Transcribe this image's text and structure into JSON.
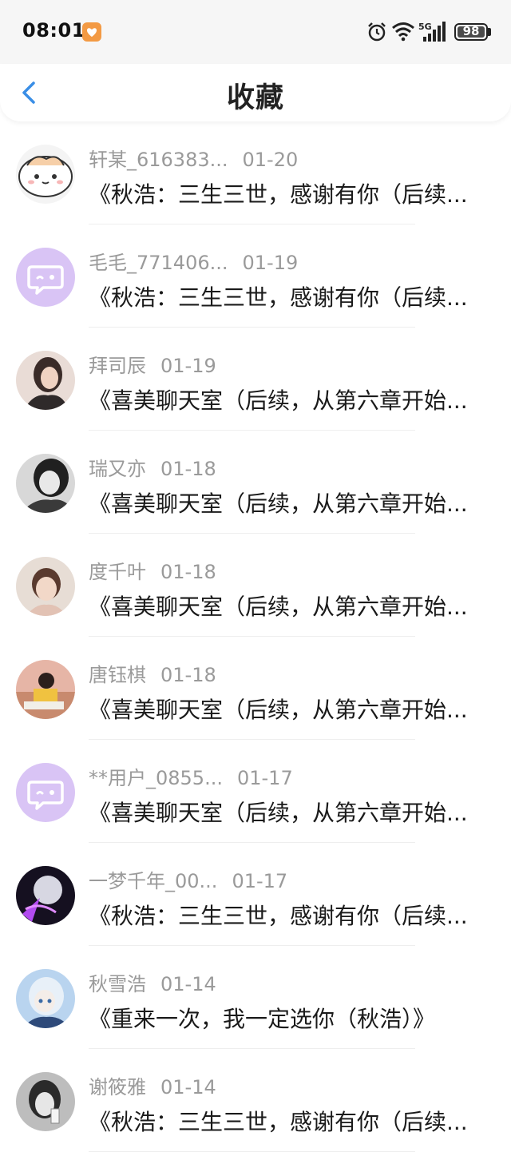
{
  "status": {
    "time": "08:01",
    "network": "5G",
    "battery": "98"
  },
  "nav": {
    "title": "收藏"
  },
  "items": [
    {
      "name": "轩某_616383...",
      "date": "01-20",
      "title": "《秋浩：三生三世，感谢有你（后续...",
      "avatar": "cat"
    },
    {
      "name": "毛毛_771406...",
      "date": "01-19",
      "title": "《秋浩：三生三世，感谢有你（后续...",
      "avatar": "chat"
    },
    {
      "name": "拜司辰",
      "date": "01-19",
      "title": "《喜美聊天室（后续，从第六章开始...",
      "avatar": "photo1"
    },
    {
      "name": "瑞又亦",
      "date": "01-18",
      "title": "《喜美聊天室（后续，从第六章开始...",
      "avatar": "photo2"
    },
    {
      "name": "度千叶",
      "date": "01-18",
      "title": "《喜美聊天室（后续，从第六章开始...",
      "avatar": "photo3"
    },
    {
      "name": "唐钰棋",
      "date": "01-18",
      "title": "《喜美聊天室（后续，从第六章开始...",
      "avatar": "photo4"
    },
    {
      "name": "**用户_0855...",
      "date": "01-17",
      "title": "《喜美聊天室（后续，从第六章开始...",
      "avatar": "chat"
    },
    {
      "name": "一梦千年_00...",
      "date": "01-17",
      "title": "《秋浩：三生三世，感谢有你（后续...",
      "avatar": "photo5"
    },
    {
      "name": "秋雪浩",
      "date": "01-14",
      "title": "《重来一次，我一定选你（秋浩）》",
      "avatar": "photo6"
    },
    {
      "name": "谢筱雅",
      "date": "01-14",
      "title": "《秋浩：三生三世，感谢有你（后续...",
      "avatar": "photo7"
    }
  ],
  "colors": {
    "accent": "#3a8ee6",
    "chat_avatar_bg": "#d9c4f5",
    "chat_avatar_fg": "#ffffff"
  }
}
